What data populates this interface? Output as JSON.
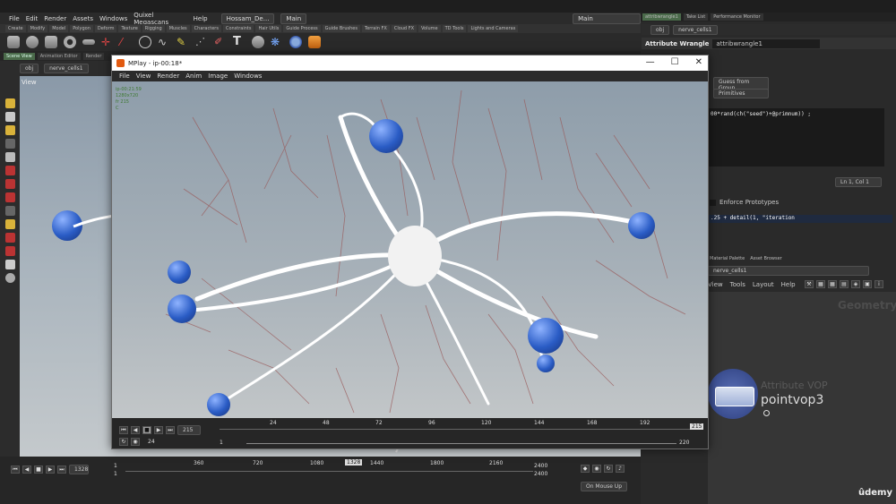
{
  "app": {
    "menu": [
      "File",
      "Edit",
      "Render",
      "Assets",
      "Windows",
      "Quixel Megascans",
      "Help"
    ],
    "desktop_name": "Hossam_De...",
    "main_label": "Main",
    "right_main_label": "Main"
  },
  "shelf": {
    "tabs": [
      "Create",
      "Modify",
      "Model",
      "Polygon",
      "Deform",
      "Texture",
      "Rigging",
      "Muscles",
      "Characters",
      "Constraints",
      "Hair Utils",
      "Guide Process",
      "Guide Brushes",
      "Terrain FX",
      "Cloud FX",
      "Volume",
      "TD Tools",
      "Lights and Cameras"
    ]
  },
  "panel": {
    "tabs": [
      "Scene View",
      "Animation Editor",
      "Render"
    ],
    "path": [
      "obj",
      "nerve_cells1"
    ],
    "view_label": "View"
  },
  "timeline": {
    "frame": "1328",
    "start": "1",
    "end": "2400",
    "start2": "1",
    "end2": "2400",
    "ticks": [
      "360",
      "720",
      "1080",
      "1440",
      "1800",
      "2160"
    ],
    "marker": "1328",
    "on_mouse_up": "On Mouse Up"
  },
  "mplay": {
    "title": "MPlay - ip-00:18*",
    "menu": [
      "File",
      "View",
      "Render",
      "Anim",
      "Image",
      "Windows"
    ],
    "stats": [
      "ip-00:21:59",
      "1280x720",
      "fr 215",
      "C"
    ],
    "frame": "215",
    "frame_box": "215",
    "fps": "24",
    "range_start": "1",
    "range_end": "220",
    "ticks": [
      "24",
      "48",
      "72",
      "96",
      "120",
      "144",
      "168",
      "192"
    ]
  },
  "right": {
    "tabs": [
      "attribwrangle1",
      "Take List",
      "Performance Monitor"
    ],
    "path": [
      "obj",
      "nerve_cells1"
    ],
    "node_type": "Attribute Wrangle",
    "node_name": "attribwrangle1",
    "group_type": "Guess from Group",
    "run_over": "Primitives",
    "code_line": "00*rand(ch(\"seed\")+@primnum)) ;",
    "cursor": "Ln 1, Col 1",
    "enforce": "Enforce Prototypes",
    "expr": ".25 + detail(1, \"iteration",
    "net_tabs": [
      "Material Palette",
      "Asset Browser"
    ],
    "net_path": "nerve_cells1",
    "net_menu": [
      "View",
      "Tools",
      "Layout",
      "Help"
    ],
    "geometry_label": "Geometry",
    "node_overlay": "Attribute VOP",
    "node_label": "pointvop3"
  },
  "watermark": "ûdemy"
}
